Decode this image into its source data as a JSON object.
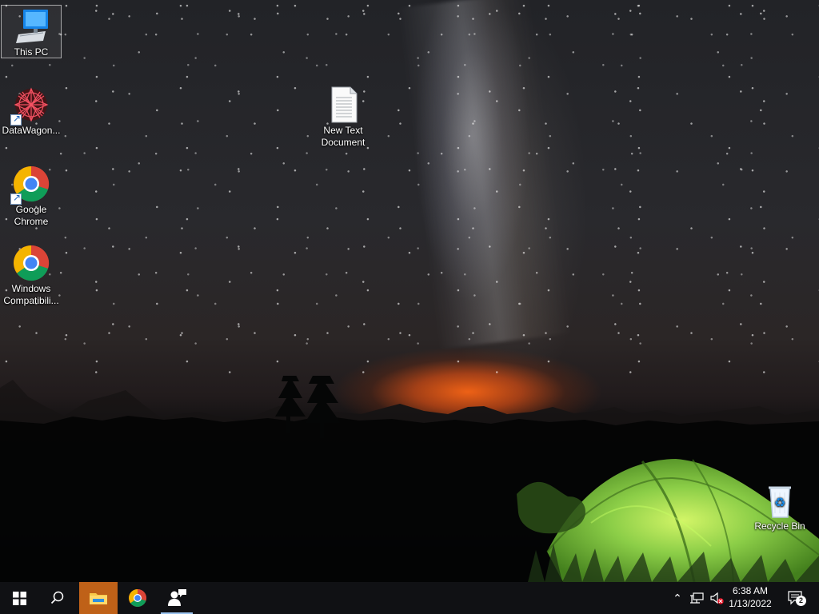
{
  "desktop": {
    "icons": [
      {
        "label": "This PC",
        "icon": "computer-icon"
      },
      {
        "label": "DataWagon...",
        "icon": "datawagon-icon"
      },
      {
        "label": "New Text\nDocument",
        "icon": "text-document-icon"
      },
      {
        "label": "Google\nChrome",
        "icon": "chrome-icon"
      },
      {
        "label": "Windows\nCompatibili...",
        "icon": "chrome-icon"
      },
      {
        "label": "Recycle Bin",
        "icon": "recycle-bin-icon"
      }
    ]
  },
  "taskbar": {
    "start_icon": "windows-start-icon",
    "search_icon": "search-icon",
    "pinned_apps": [
      {
        "name": "File Explorer",
        "icon": "folder-icon"
      },
      {
        "name": "Google Chrome",
        "icon": "chrome-icon"
      },
      {
        "name": "Contacts",
        "icon": "person-chat-icon"
      }
    ],
    "tray": {
      "time": "6:38 AM",
      "date": "1/13/2022",
      "notification_count": "2"
    }
  },
  "colors": {
    "taskbar_bg": "#101114",
    "active_orange": "#bf6118",
    "tent_green": "#91d64a"
  }
}
